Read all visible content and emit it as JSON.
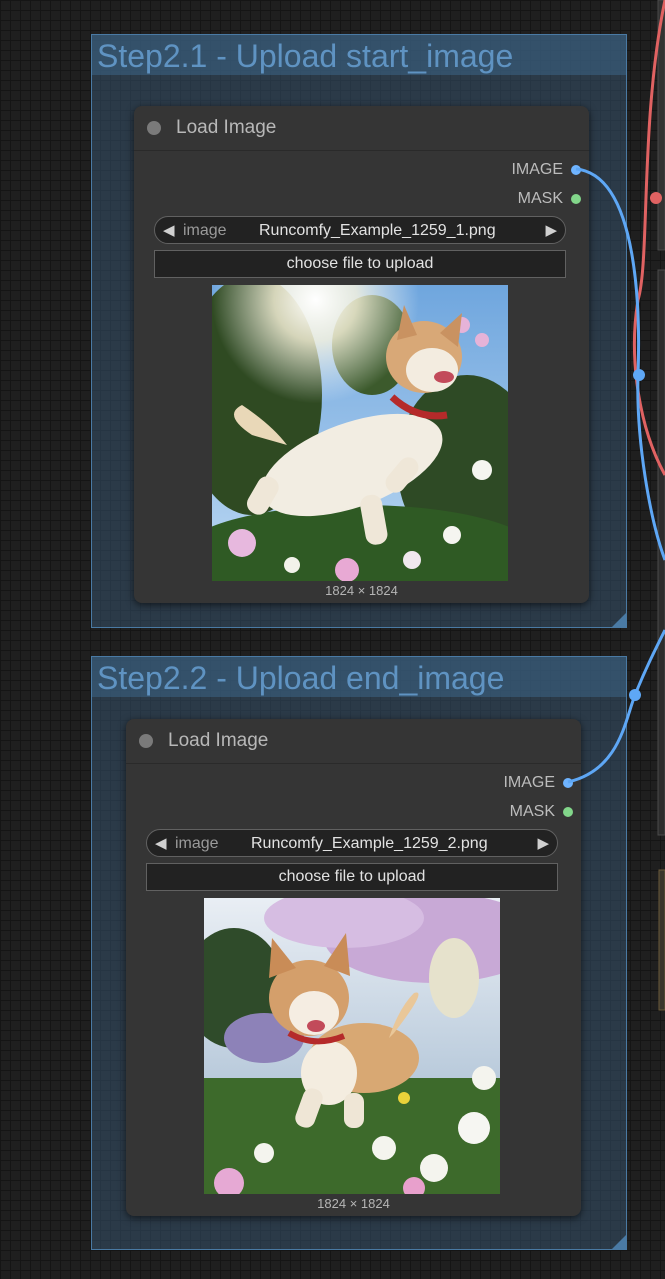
{
  "groups": [
    {
      "title": "Step2.1 - Upload start_image",
      "node": {
        "title": "Load Image",
        "outputs": [
          {
            "label": "IMAGE",
            "color": "#6fb4ff"
          },
          {
            "label": "MASK",
            "color": "#82d68a"
          }
        ],
        "image_widget": {
          "name": "image",
          "value": "Runcomfy_Example_1259_1.png",
          "prev": "◀",
          "next": "▶"
        },
        "upload_label": "choose file to upload",
        "preview_size": "1824 × 1824"
      }
    },
    {
      "title": "Step2.2 - Upload end_image",
      "node": {
        "title": "Load Image",
        "outputs": [
          {
            "label": "IMAGE",
            "color": "#6fb4ff"
          },
          {
            "label": "MASK",
            "color": "#82d68a"
          }
        ],
        "image_widget": {
          "name": "image",
          "value": "Runcomfy_Example_1259_2.png",
          "prev": "◀",
          "next": "▶"
        },
        "upload_label": "choose file to upload",
        "preview_size": "1824 × 1824"
      }
    }
  ],
  "colors": {
    "image_link": "#5ea7f5",
    "clip_link": "#e06262",
    "group_border": "#4a7aa4",
    "node_bg": "#353535"
  }
}
